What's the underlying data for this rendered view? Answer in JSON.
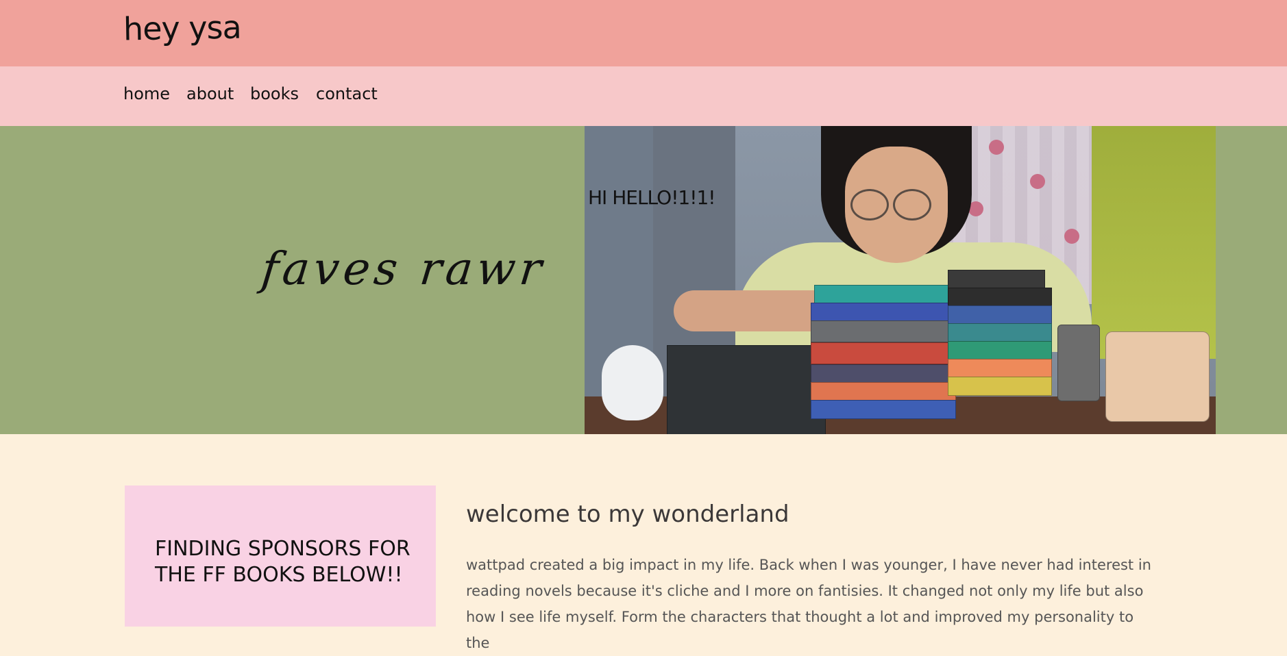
{
  "header": {
    "site_title": "hey ysa"
  },
  "nav": {
    "items": [
      {
        "label": "home"
      },
      {
        "label": "about"
      },
      {
        "label": "books"
      },
      {
        "label": "contact"
      }
    ]
  },
  "hero": {
    "tagline": "faves rawr",
    "greeting": "HI HELLO!1!1!",
    "photo_alt": "girl resting her head on stacks of books"
  },
  "sponsor_card": {
    "heading": "FINDING SPONSORS FOR THE FF BOOKS BELOW!!"
  },
  "main": {
    "heading": "welcome to my wonderland",
    "body": "wattpad created a big impact in my life. Back when I was younger, I have never had interest in reading novels because it's cliche and I more on fantisies. It changed not only my life but also how I see life myself. Form the characters that thought a lot and improved my personality to the"
  },
  "colors": {
    "topbar": "#f0a29b",
    "navbar": "#f7c8c9",
    "hero_bg": "#9aab78",
    "page_bg": "#fdf0dc",
    "sponsor_card_bg": "#f9d2e4"
  }
}
